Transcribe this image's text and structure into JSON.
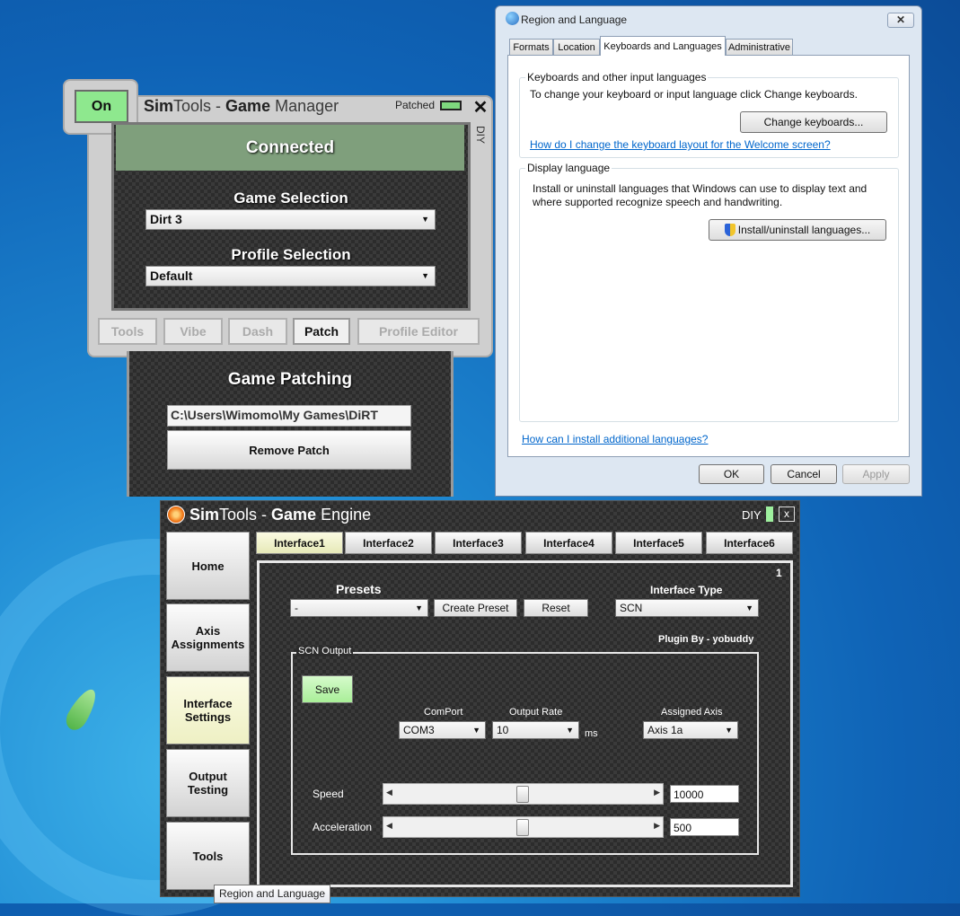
{
  "game_manager": {
    "on_label": "On",
    "title_sim": "Sim",
    "title_tools": "Tools - ",
    "title_game": "Game",
    "title_manager": " Manager",
    "patched_label": "Patched",
    "close_label": "✕",
    "diy_label": "DIY",
    "status": "Connected",
    "game_selection_label": "Game Selection",
    "game_selection_value": "Dirt 3",
    "profile_selection_label": "Profile Selection",
    "profile_selection_value": "Default",
    "tabs": [
      {
        "label": "Tools"
      },
      {
        "label": "Vibe"
      },
      {
        "label": "Dash"
      },
      {
        "label": "Patch"
      },
      {
        "label": "Profile Editor"
      }
    ],
    "patching_title": "Game Patching",
    "patch_path": "C:\\Users\\Wimomo\\My Games\\DiRT",
    "remove_patch_label": "Remove Patch",
    "colors": {
      "on": "#8ee88e",
      "connected": "#7f9f7c",
      "patched_led": "#7ed87e"
    }
  },
  "region_language": {
    "title": "Region and Language",
    "close_label": "✕",
    "tabs": [
      {
        "label": "Formats"
      },
      {
        "label": "Location"
      },
      {
        "label": "Keyboards and Languages"
      },
      {
        "label": "Administrative"
      }
    ],
    "keyboards_group": "Keyboards and other input languages",
    "keyboards_text": "To change your keyboard or input language click Change keyboards.",
    "change_keyboards_label": "Change keyboards...",
    "welcome_link": "How do I change the keyboard layout for the Welcome screen?",
    "display_group": "Display language",
    "display_text_1": "Install or uninstall languages that Windows can use to display text and",
    "display_text_2": "where supported recognize speech and handwriting.",
    "install_label": "Install/uninstall languages...",
    "additional_link": "How can I install additional languages?",
    "ok_label": "OK",
    "cancel_label": "Cancel",
    "apply_label": "Apply"
  },
  "game_engine": {
    "title_sim": "Sim",
    "title_tools": "Tools - ",
    "title_game": "Game",
    "title_engine": " Engine",
    "diy_label": "DIY",
    "close_label": "x",
    "sidebar": [
      {
        "label": "Home"
      },
      {
        "label": "Axis Assignments"
      },
      {
        "label": "Interface Settings"
      },
      {
        "label": "Output Testing"
      },
      {
        "label": "Tools"
      }
    ],
    "interface_tabs": [
      {
        "label": "Interface1"
      },
      {
        "label": "Interface2"
      },
      {
        "label": "Interface3"
      },
      {
        "label": "Interface4"
      },
      {
        "label": "Interface5"
      },
      {
        "label": "Interface6"
      }
    ],
    "interface_number": "1",
    "presets_label": "Presets",
    "presets_value": "-",
    "create_preset_label": "Create Preset",
    "reset_label": "Reset",
    "interface_type_label": "Interface Type",
    "interface_type_value": "SCN",
    "plugin_by": "Plugin By - yobuddy",
    "scn_output_label": "SCN Output",
    "save_label": "Save",
    "comport_label": "ComPort",
    "comport_value": "COM3",
    "output_rate_label": "Output Rate",
    "output_rate_value": "10",
    "ms_label": "ms",
    "assigned_axis_label": "Assigned Axis",
    "assigned_axis_value": "Axis 1a",
    "speed_label": "Speed",
    "speed_value": "10000",
    "acceleration_label": "Acceleration",
    "acceleration_value": "500",
    "colors": {
      "active_tab": "#e6e9b8",
      "save": "#b9f5a9"
    }
  },
  "taskbar_tooltip": "Region and Language"
}
